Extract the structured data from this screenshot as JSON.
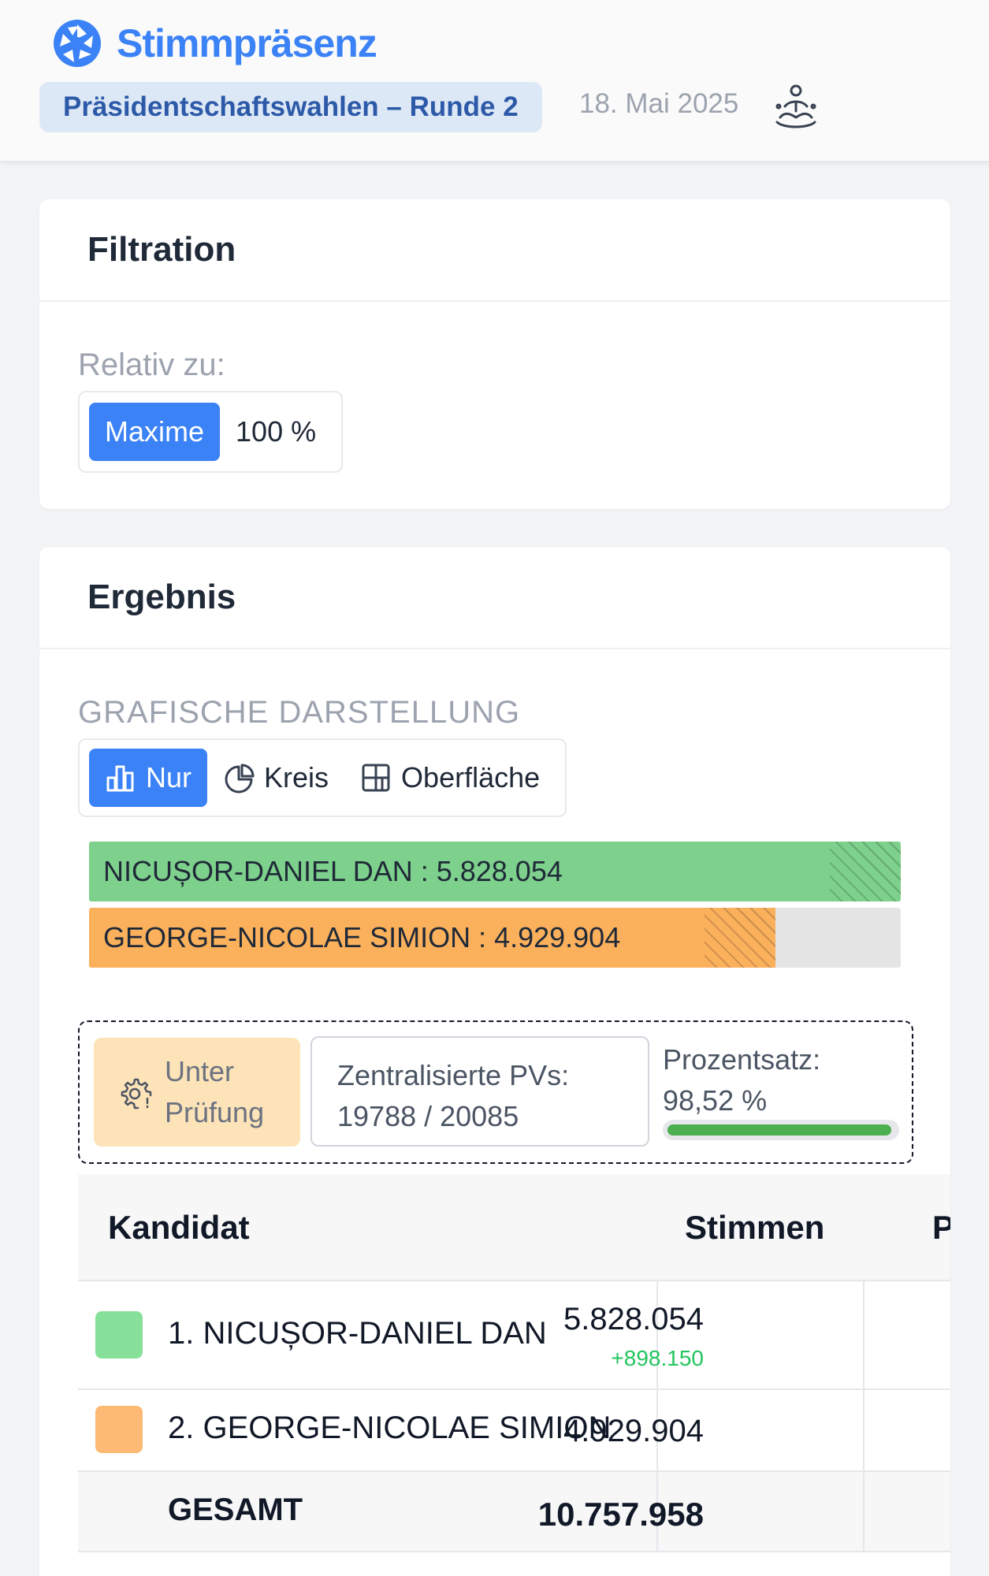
{
  "header": {
    "app_name": "Stimmpräsenz",
    "election": "Präsidentschaftswahlen – Runde 2",
    "date": "18. Mai 2025"
  },
  "filter": {
    "title": "Filtration",
    "relative_label": "Relativ zu:",
    "options": [
      "Maxime",
      "100 %"
    ],
    "selected": "Maxime"
  },
  "result": {
    "title": "Ergebnis",
    "graph_label": "GRAFISCHE DARSTELLUNG",
    "graph_options": [
      "Nur",
      "Kreis",
      "Oberfläche"
    ],
    "graph_selected": "Nur"
  },
  "chart_data": {
    "type": "bar",
    "categories": [
      "NICUȘOR-DANIEL DAN",
      "GEORGE-NICOLAE SIMION"
    ],
    "values": [
      5828054,
      4929904
    ],
    "labels": [
      "NICUȘOR-DANIEL DAN : 5.828.054",
      "GEORGE-NICOLAE SIMION : 4.929.904"
    ],
    "colors": [
      "#7dd18c",
      "#fbb05c"
    ],
    "relative_to": "max"
  },
  "status": {
    "badge": "Unter Prüfung",
    "badge_line1": "Unter",
    "badge_line2": "Prüfung",
    "pv_label": "Zentralisierte PVs:",
    "pv_value": "19788 / 20085",
    "pct_label": "Prozentsatz:",
    "pct_value": "98,52 %",
    "pct_fraction": 0.9852
  },
  "table": {
    "headers": [
      "Kandidat",
      "Stimmen",
      "P"
    ],
    "rows": [
      {
        "rank_name": "1. NICUȘOR-DANIEL DAN",
        "votes": "5.828.054",
        "delta": "+898.150",
        "color": "#86e09a"
      },
      {
        "rank_name": "2. GEORGE-NICOLAE SIMION",
        "votes": "4.929.904",
        "delta": "",
        "color": "#fdba74"
      }
    ],
    "total_label": "GESAMT",
    "total_votes": "10.757.958"
  }
}
